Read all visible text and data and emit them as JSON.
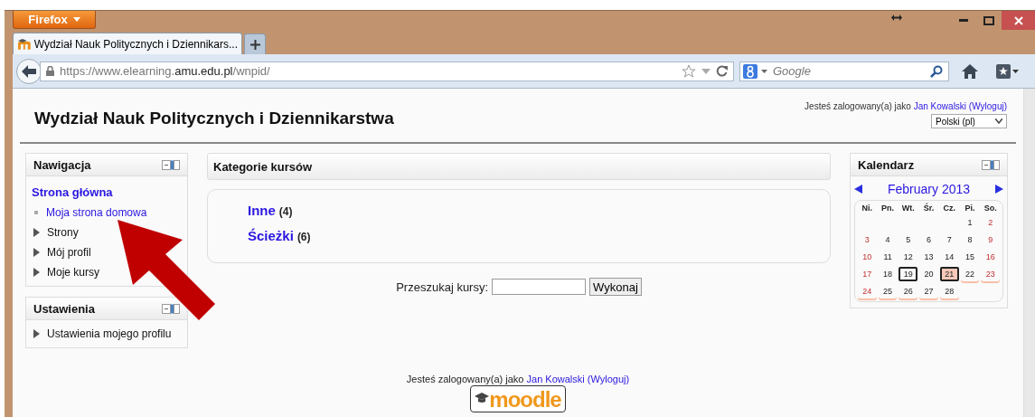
{
  "browser": {
    "menu_button": "Firefox",
    "tabs": [
      {
        "title": "Wydział Nauk Politycznych i Dziennikars...",
        "selected": true
      }
    ],
    "address": {
      "prefix": "https://www.elearning.",
      "domain": "amu.edu.pl",
      "path": "/wnpid/"
    },
    "search": {
      "placeholder": "Google"
    }
  },
  "page": {
    "title": "Wydział Nauk Politycznych i Dziennikarstwa",
    "login": {
      "text": "Jesteś zalogowany(a) jako",
      "user": "Jan Kowalski",
      "logout": "(Wyloguj)"
    },
    "language": "Polski (pl)",
    "navigation": {
      "title": "Nawigacja",
      "items": [
        {
          "label": "Strona główna",
          "children": [
            {
              "label": "Moja strona domowa",
              "kind": "leaf"
            },
            {
              "label": "Strony",
              "kind": "branch"
            },
            {
              "label": "Mój profil",
              "kind": "branch"
            },
            {
              "label": "Moje kursy",
              "kind": "branch"
            }
          ]
        }
      ]
    },
    "settings": {
      "title": "Ustawienia",
      "items": [
        {
          "label": "Ustawienia mojego profilu",
          "kind": "branch"
        }
      ]
    },
    "categories": {
      "title": "Kategorie kursów",
      "items": [
        {
          "name": "Inne",
          "count": "(4)"
        },
        {
          "name": "Ścieżki",
          "count": "(6)"
        }
      ]
    },
    "course_search": {
      "label": "Przeszukaj kursy:",
      "button": "Wykonaj"
    },
    "calendar": {
      "title": "Kalendarz",
      "month": "February 2013",
      "weekdays": [
        "Ni.",
        "Pn.",
        "Wt.",
        "Śr.",
        "Cz.",
        "Pi.",
        "So."
      ],
      "weeks": [
        [
          {
            "day": "1",
            "weekend": false,
            "boxed": false,
            "today": false,
            "upcoming": false
          },
          {
            "day": "2",
            "weekend": true,
            "boxed": false,
            "today": false,
            "upcoming": false
          }
        ],
        [
          {
            "day": "3",
            "weekend": true,
            "boxed": false,
            "today": false,
            "upcoming": false
          },
          {
            "day": "4",
            "weekend": false,
            "boxed": false,
            "today": false,
            "upcoming": false
          },
          {
            "day": "5",
            "weekend": false,
            "boxed": false,
            "today": false,
            "upcoming": false
          },
          {
            "day": "6",
            "weekend": false,
            "boxed": false,
            "today": false,
            "upcoming": false
          },
          {
            "day": "7",
            "weekend": false,
            "boxed": false,
            "today": false,
            "upcoming": false
          },
          {
            "day": "8",
            "weekend": false,
            "boxed": false,
            "today": false,
            "upcoming": false
          },
          {
            "day": "9",
            "weekend": true,
            "boxed": false,
            "today": false,
            "upcoming": false
          }
        ],
        [
          {
            "day": "10",
            "weekend": true,
            "boxed": false,
            "today": false,
            "upcoming": false
          },
          {
            "day": "11",
            "weekend": false,
            "boxed": false,
            "today": false,
            "upcoming": false
          },
          {
            "day": "12",
            "weekend": false,
            "boxed": false,
            "today": false,
            "upcoming": false
          },
          {
            "day": "13",
            "weekend": false,
            "boxed": false,
            "today": false,
            "upcoming": false
          },
          {
            "day": "14",
            "weekend": false,
            "boxed": false,
            "today": false,
            "upcoming": false
          },
          {
            "day": "15",
            "weekend": false,
            "boxed": false,
            "today": false,
            "upcoming": false
          },
          {
            "day": "16",
            "weekend": true,
            "boxed": false,
            "today": false,
            "upcoming": false
          }
        ],
        [
          {
            "day": "17",
            "weekend": true,
            "boxed": false,
            "today": false,
            "upcoming": false
          },
          {
            "day": "18",
            "weekend": false,
            "boxed": false,
            "today": false,
            "upcoming": false
          },
          {
            "day": "19",
            "weekend": false,
            "boxed": true,
            "today": false,
            "upcoming": false
          },
          {
            "day": "20",
            "weekend": false,
            "boxed": false,
            "today": false,
            "upcoming": false
          },
          {
            "day": "21",
            "weekend": false,
            "boxed": true,
            "today": true,
            "upcoming": false
          },
          {
            "day": "22",
            "weekend": false,
            "boxed": false,
            "today": false,
            "upcoming": true
          },
          {
            "day": "23",
            "weekend": true,
            "boxed": false,
            "today": false,
            "upcoming": true
          }
        ],
        [
          {
            "day": "24",
            "weekend": true,
            "boxed": false,
            "today": false,
            "upcoming": true
          },
          {
            "day": "25",
            "weekend": false,
            "boxed": false,
            "today": false,
            "upcoming": true
          },
          {
            "day": "26",
            "weekend": false,
            "boxed": false,
            "today": false,
            "upcoming": true
          },
          {
            "day": "27",
            "weekend": false,
            "boxed": false,
            "today": false,
            "upcoming": true
          },
          {
            "day": "28",
            "weekend": false,
            "boxed": false,
            "today": false,
            "upcoming": true
          }
        ]
      ]
    },
    "footer": {
      "text": "Jesteś zalogowany(a) jako",
      "user": "Jan Kowalski",
      "logout": "(Wyloguj)",
      "logo": "moodle"
    }
  }
}
